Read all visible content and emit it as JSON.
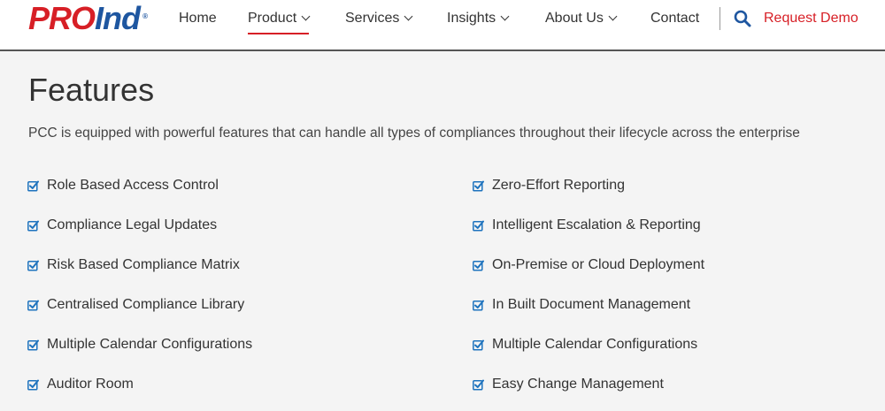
{
  "header": {
    "logo": {
      "part1": "PRO",
      "part2": "Ind",
      "mark": "®"
    },
    "nav": [
      {
        "label": "Home",
        "has_dropdown": false,
        "active": false
      },
      {
        "label": "Product",
        "has_dropdown": true,
        "active": true
      },
      {
        "label": "Services",
        "has_dropdown": true,
        "active": false
      },
      {
        "label": "Insights",
        "has_dropdown": true,
        "active": false
      },
      {
        "label": "About Us",
        "has_dropdown": true,
        "active": false
      },
      {
        "label": "Contact",
        "has_dropdown": false,
        "active": false
      }
    ],
    "search_icon": "search-icon",
    "request_demo": "Request Demo",
    "colors": {
      "brand_red": "#d71f26",
      "brand_blue": "#1e56a0"
    }
  },
  "main": {
    "title": "Features",
    "subtitle": "PCC is equipped with powerful features that can handle all types of compliances throughout their lifecycle across the enterprise",
    "features_left": [
      "Role Based Access Control",
      "Compliance Legal Updates",
      "Risk Based Compliance Matrix",
      "Centralised Compliance Library",
      "Multiple Calendar Configurations",
      "Auditor Room"
    ],
    "features_right": [
      "Zero-Effort Reporting",
      "Intelligent Escalation & Reporting",
      "On-Premise or Cloud Deployment",
      "In Built Document Management",
      "Multiple Calendar Configurations",
      "Easy Change Management"
    ],
    "check_icon": "checkbox-checked-icon",
    "check_color": "#1e73be"
  }
}
